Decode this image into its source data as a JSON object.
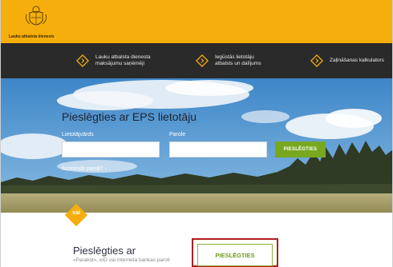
{
  "header": {
    "org_name": "Lauku atbalsta dienests"
  },
  "nav": {
    "items": [
      {
        "label_line1": "Lauku atbalsta dienesta",
        "label_line2": "maksājumu saņēmēji"
      },
      {
        "label_line1": "Iegūstās lietotāju",
        "label_line2": "atbalsts un dalījums"
      },
      {
        "label_line1": "Zaļināšanas kalkulators",
        "label_line2": ""
      }
    ]
  },
  "login": {
    "title": "Pieslēgties ar EPS lietotāju",
    "username_label": "Lietotājvārds",
    "password_label": "Parole",
    "username_value": "",
    "password_value": "",
    "submit_label": "PIESLĒGTIES",
    "forgot_label": "Aizmirsāt paroli? ›"
  },
  "alt_login": {
    "or_label": "vai",
    "title": "Pieslēgties ar",
    "subtitle": "«Parakst», eID vai interneta bankas paroli",
    "button_label": "PIESLĒGTIES"
  },
  "colors": {
    "brand_orange": "#f6ae0c",
    "nav_dark": "#2a2a2a",
    "accent_green": "#78a820",
    "highlight_red": "#b01e1e"
  }
}
